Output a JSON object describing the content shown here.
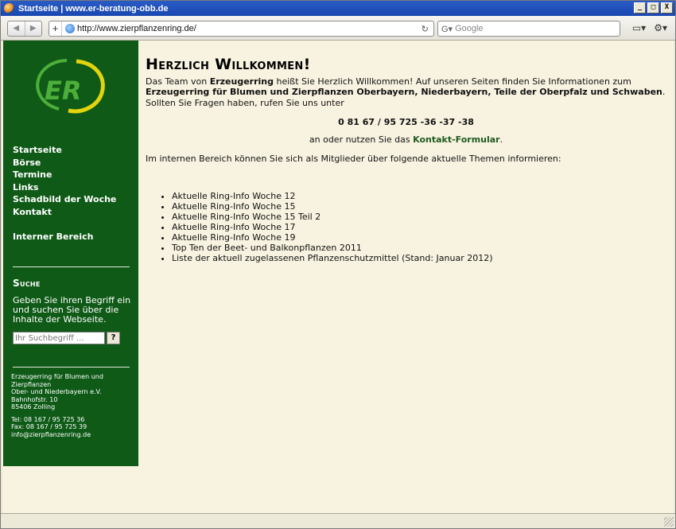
{
  "window": {
    "title": "Startseite | www.er-beratung-obb.de",
    "buttons": [
      "_",
      "□",
      "X"
    ]
  },
  "browser": {
    "url": "http://www.zierpflanzenring.de/",
    "search_placeholder": "Google",
    "new_tab": "+",
    "reload": "↻"
  },
  "sidebar": {
    "nav": [
      "Startseite",
      "Börse",
      "Termine",
      "Links",
      "Schadbild der Woche",
      "Kontakt"
    ],
    "intern": "Interner Bereich",
    "search_title": "Suche",
    "search_desc": "Geben Sie ihren Begriff ein und suchen Sie über die Inhalte der Webseite.",
    "search_placeholder": "Ihr Suchbegriff ...",
    "search_button": "?",
    "address": [
      "Erzeugerring für Blumen und Zierpflanzen",
      "Ober- und Niederbayern e.V.",
      "Bahnhofstr. 10",
      "85406 Zolling"
    ],
    "contact": [
      "Tel: 08 167 / 95 725 36",
      "Fax: 08 167 / 95 725 39",
      "info@zierpflanzenring.de"
    ],
    "logo_text": "ER"
  },
  "main": {
    "heading": "Herzlich Willkommen!",
    "intro_1": "Das Team von ",
    "intro_bold_1": "Erzeugerring",
    "intro_2": " heißt Sie Herzlich Willkommen! Auf unseren Seiten finden Sie Informationen zum ",
    "intro_bold_2": "Erzeugerring für Blumen und Zierpflanzen Oberbayern, Niederbayern, Teile der Oberpfalz und Schwaben",
    "intro_3": ". Sollten Sie Fragen haben, rufen Sie uns unter",
    "phone": "0 81 67 / 95 725 -36  -37  -38",
    "contact_pre": "an oder nutzen Sie das ",
    "contact_link": "Kontakt-Formular",
    "contact_post": ".",
    "members_text": "Im internen Bereich können Sie sich als Mitglieder über folgende aktuelle Themen informieren:",
    "topics": [
      "Aktuelle Ring-Info Woche 12",
      "Aktuelle Ring-Info Woche 15",
      "Aktuelle Ring-Info Woche 15 Teil 2",
      "Aktuelle Ring-Info Woche 17",
      "Aktuelle Ring-Info Woche 19",
      "Top Ten der Beet- und Balkonpflanzen 2011",
      "Liste der aktuell zugelassenen Pflanzenschutzmittel (Stand: Januar 2012)"
    ]
  },
  "colors": {
    "sidebar_bg": "#0f5a17",
    "page_bg": "#f8f3e1",
    "logo_yellow": "#e2d40f",
    "logo_green": "#4caf3a"
  }
}
